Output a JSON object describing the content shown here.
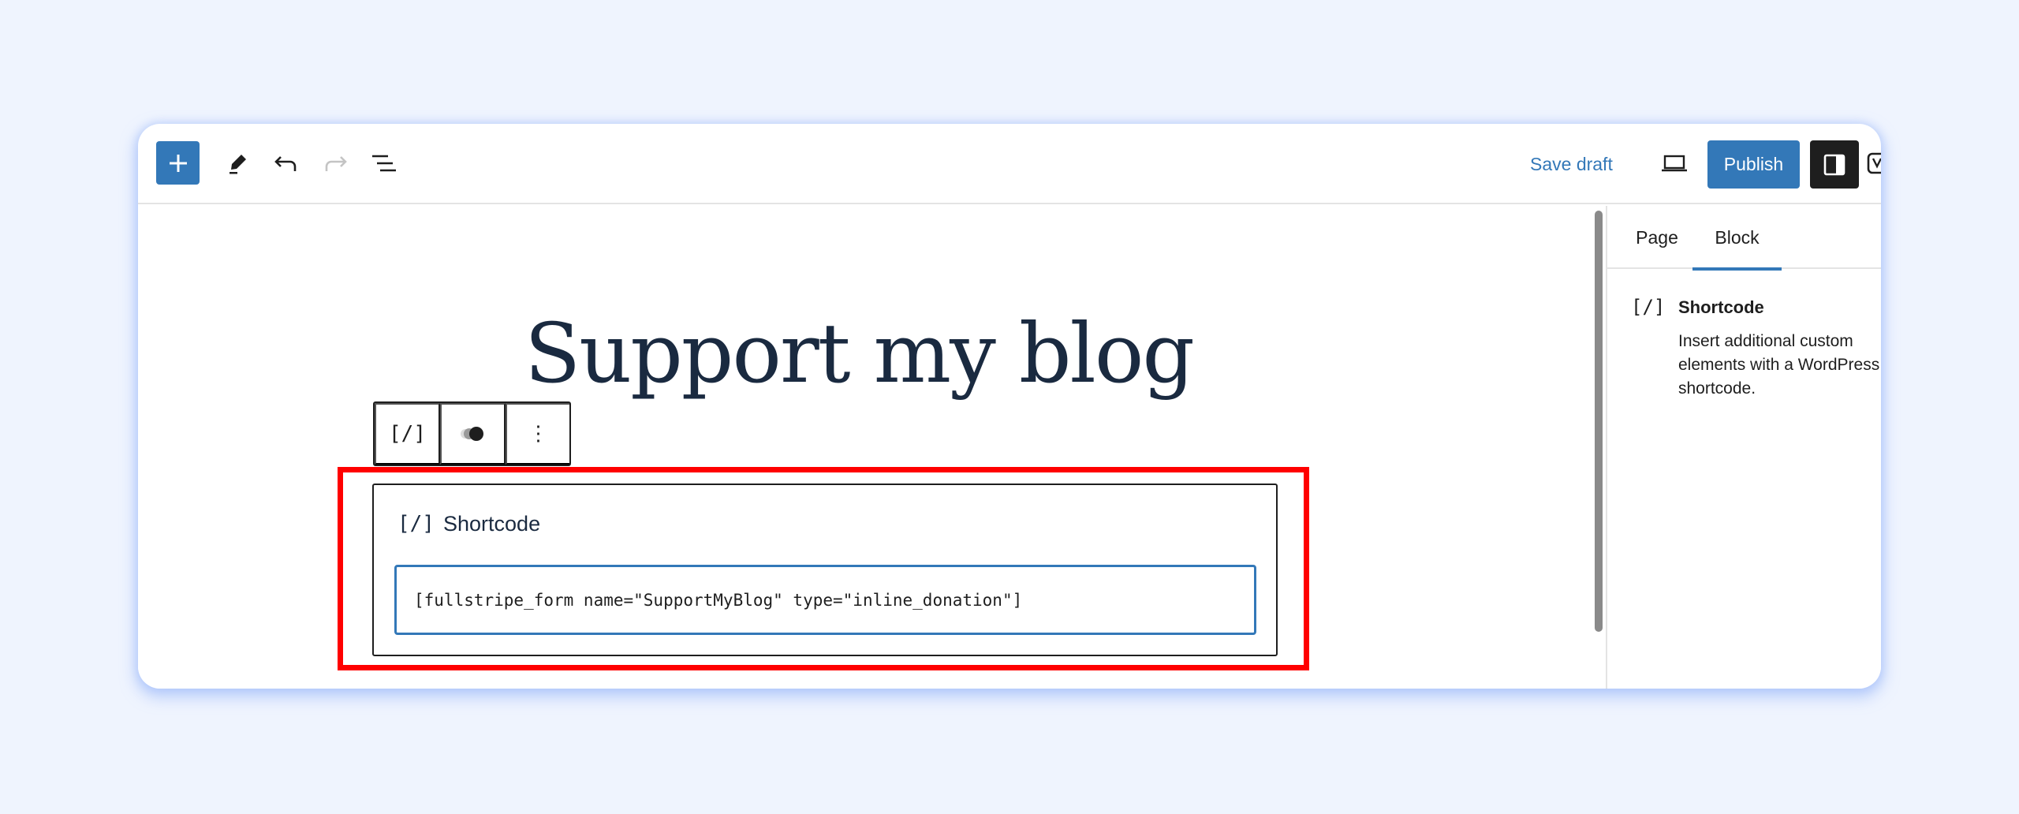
{
  "header": {
    "add_block_label": "Add block",
    "tools": [
      "pencil",
      "undo",
      "redo",
      "list-view"
    ],
    "save_draft": "Save draft",
    "publish": "Publish"
  },
  "canvas": {
    "title": "Support my blog",
    "block_toolbar": {
      "block_type_icon": "[/]",
      "more_options": "⋮"
    },
    "shortcode_block": {
      "icon": "[/]",
      "label": "Shortcode",
      "value": "[fullstripe_form name=\"SupportMyBlog\" type=\"inline_donation\"]"
    }
  },
  "sidebar": {
    "tabs": [
      {
        "label": "Page",
        "active": false
      },
      {
        "label": "Block",
        "active": true
      }
    ],
    "block_card": {
      "icon": "[/]",
      "title": "Shortcode",
      "description": "Insert additional custom elements with a WordPress shortcode."
    }
  },
  "colors": {
    "accent": "#3378b8",
    "highlight": "#ff0000",
    "dark": "#1e1e1e",
    "title": "#1a2a40"
  }
}
